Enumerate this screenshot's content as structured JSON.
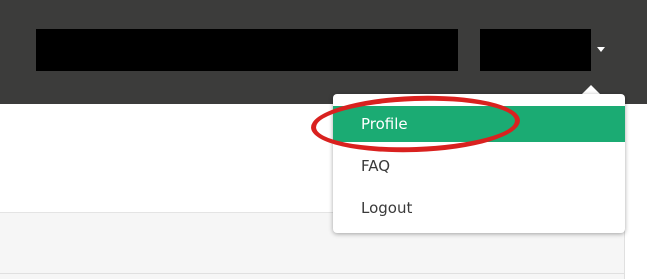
{
  "header": {
    "redacted_username": "",
    "redacted_account": "",
    "caret_icon": "caret-down-icon",
    "background_color": "#3c3c3b"
  },
  "dropdown": {
    "items": [
      {
        "label": "Profile",
        "active": true
      },
      {
        "label": "FAQ",
        "active": false
      },
      {
        "label": "Logout",
        "active": false
      }
    ],
    "active_color": "#1bab73"
  },
  "annotation": {
    "shape": "ellipse",
    "color": "#d9211f",
    "highlights": "Profile"
  }
}
